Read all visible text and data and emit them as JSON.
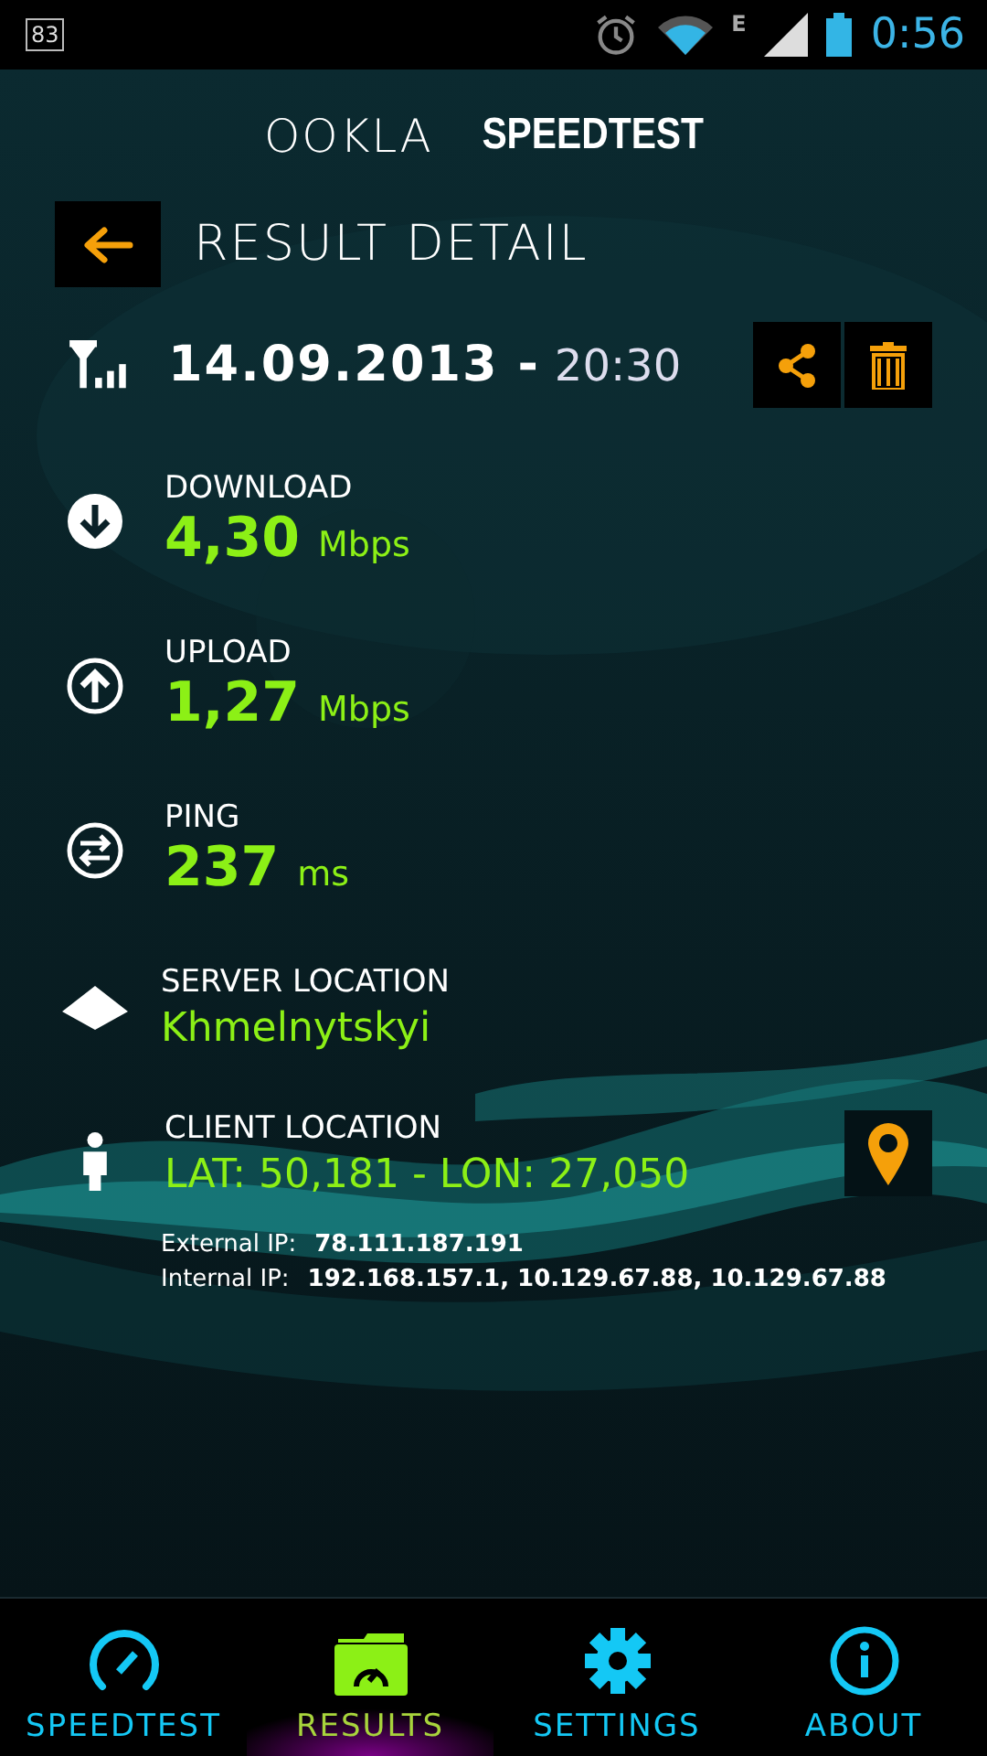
{
  "status_bar": {
    "notification": "83",
    "network_type": "E",
    "time": "0:56"
  },
  "logo": {
    "brand": "OOKLA",
    "product": "SPEEDTEST"
  },
  "header": {
    "title": "RESULT DETAIL"
  },
  "result": {
    "date": "14.09.2013 -",
    "time": "20:30"
  },
  "metrics": [
    {
      "kind": "download",
      "label": "DOWNLOAD",
      "value": "4,30",
      "unit": "Mbps"
    },
    {
      "kind": "upload",
      "label": "UPLOAD",
      "value": "1,27",
      "unit": "Mbps"
    },
    {
      "kind": "ping",
      "label": "PING",
      "value": "237",
      "unit": "ms"
    }
  ],
  "server_location": {
    "label": "SERVER LOCATION",
    "value": "Khmelnytskyi"
  },
  "client_location": {
    "label": "CLIENT LOCATION",
    "value": "LAT: 50,181 - LON: 27,050"
  },
  "ips": [
    {
      "label": "External IP:",
      "value": "78.111.187.191"
    },
    {
      "label": "Internal IP:",
      "value": "192.168.157.1, 10.129.67.88, 10.129.67.88"
    }
  ],
  "nav": [
    {
      "kind": "speedtest",
      "label": "SPEEDTEST",
      "selected": false
    },
    {
      "kind": "results",
      "label": "RESULTS",
      "selected": true
    },
    {
      "kind": "settings",
      "label": "SETTINGS",
      "selected": false
    },
    {
      "kind": "about",
      "label": "ABOUT",
      "selected": false
    }
  ]
}
